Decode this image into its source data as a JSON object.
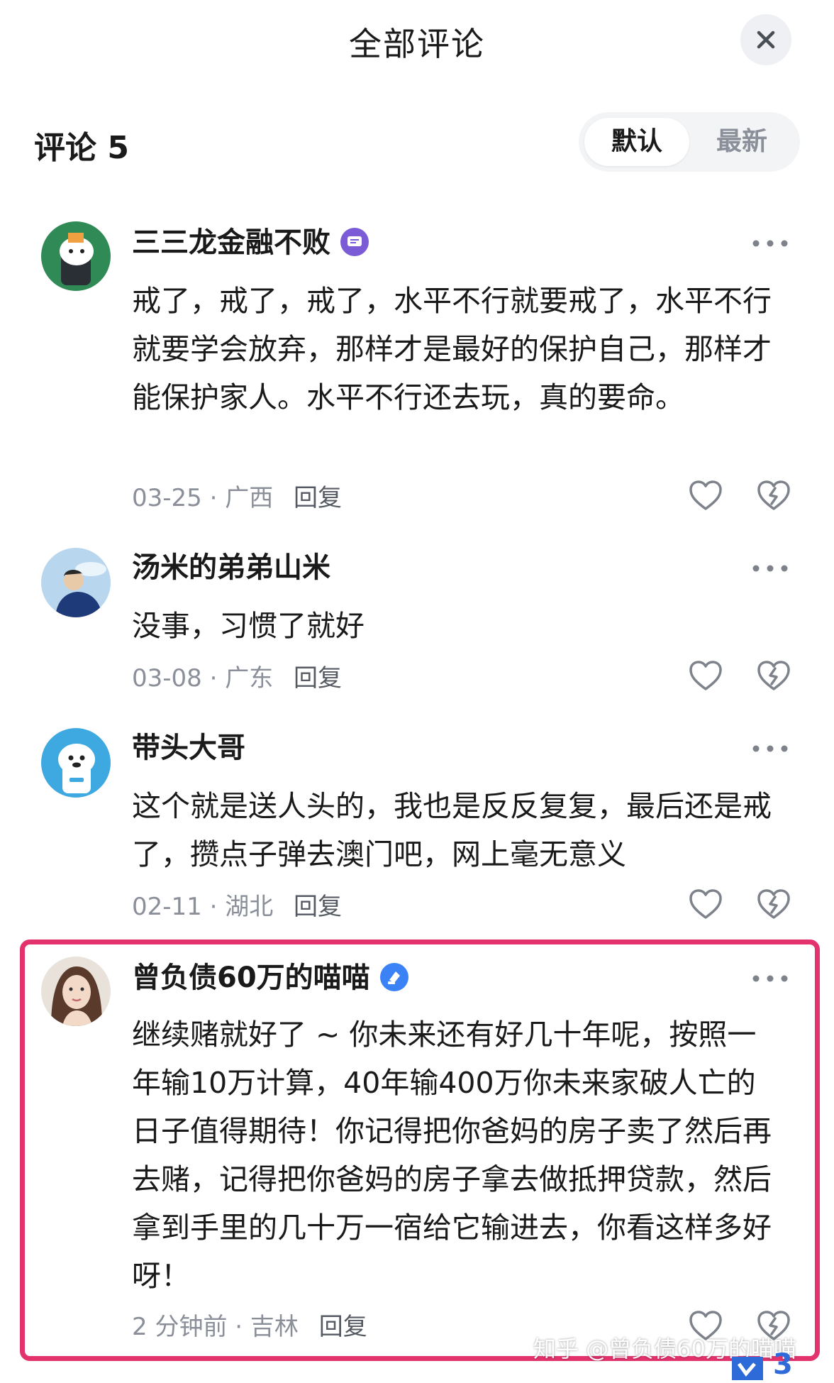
{
  "header": {
    "title": "全部评论"
  },
  "comments_header": {
    "count_label": "评论 5"
  },
  "sort": {
    "active": "默认",
    "inactive": "最新"
  },
  "comments": [
    {
      "author": "三三龙金融不败",
      "text": "戒了，戒了，戒了，水平不行就要戒了，水平不行就要学会放弃，那样才是最好的保护自己，那样才能保护家人。水平不行还去玩，真的要命。",
      "date": "03-25",
      "location": "广西",
      "reply_label": "回复"
    },
    {
      "author": "汤米的弟弟山米",
      "text": "没事，习惯了就好",
      "date": "03-08",
      "location": "广东",
      "reply_label": "回复"
    },
    {
      "author": "带头大哥",
      "text": "这个就是送人头的，我也是反反复复，最后还是戒了，攒点子弹去澳门吧，网上毫无意义",
      "date": "02-11",
      "location": "湖北",
      "reply_label": "回复"
    },
    {
      "author": "曾负债60万的喵喵",
      "text": "继续赌就好了 ~ 你未来还有好几十年呢，按照一年输10万计算，40年输400万你未来家破人亡的日子值得期待！你记得把你爸妈的房子卖了然后再去赌，记得把你爸妈的房子拿去做抵押贷款，然后拿到手里的几十万一宿给它输进去，你看这样多好呀！",
      "date": "2 分钟前",
      "location": "吉林",
      "reply_label": "回复"
    }
  ],
  "watermark": "知乎 @曾负债60万的喵喵",
  "corner_fragment": "3",
  "colors": {
    "highlight": "#e2336d",
    "muted": "#8a8f99",
    "text": "#1a1a1a",
    "badge_purple": "#7b5cd6",
    "badge_blue": "#3b82f6"
  }
}
